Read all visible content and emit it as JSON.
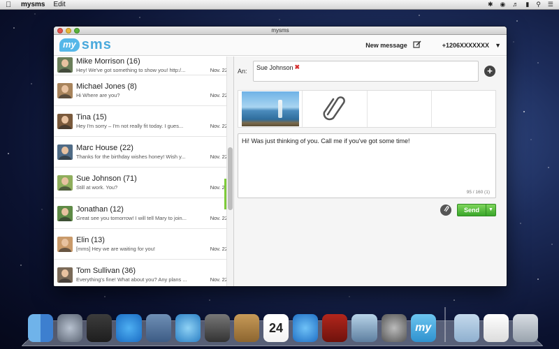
{
  "menubar": {
    "app_name": "mysms",
    "menu_edit": "Edit"
  },
  "window": {
    "title": "mysms"
  },
  "header": {
    "logo_my": "my",
    "logo_sms": "sms",
    "new_message_label": "New message",
    "phone_number": "+1206XXXXXXX"
  },
  "conversations": [
    {
      "name": "Mike Morrison (16)",
      "preview": "Hey! We've got something to show you! http:/...",
      "date": "Nov. 22",
      "avatar_color": "#6b7f5a"
    },
    {
      "name": "Michael Jones (8)",
      "preview": "Hi Where are you?",
      "date": "Nov. 22",
      "avatar_color": "#a8845c"
    },
    {
      "name": "Tina (15)",
      "preview": "Hey I'm sorry – I'm not really fit today. I gues...",
      "date": "Nov. 22",
      "avatar_color": "#7a5a3c"
    },
    {
      "name": "Marc House (22)",
      "preview": "Thanks for the birthday wishes honey! Wish y...",
      "date": "Nov. 22",
      "avatar_color": "#4f6b86"
    },
    {
      "name": "Sue Johnson (71)",
      "preview": "Still at work. You?",
      "date": "Nov. 22",
      "avatar_color": "#8fae5c"
    },
    {
      "name": "Jonathan (12)",
      "preview": "Great see you tomorrow! I will tell Mary to join...",
      "date": "Nov. 22",
      "avatar_color": "#5e8a46"
    },
    {
      "name": "Elin (13)",
      "preview": "[mms] Hey we are waiting for you!",
      "date": "Nov. 22",
      "avatar_color": "#c99a6a"
    },
    {
      "name": "Tom Sullivan (36)",
      "preview": "Everything's fine! What about you? Any plans ...",
      "date": "Nov. 22",
      "avatar_color": "#7a6a58"
    }
  ],
  "compose": {
    "to_label": "An:",
    "recipient": "Sue Johnson",
    "message": "Hi! Was just thinking of you. Call me if you've got some time!",
    "counter": "95 / 160 (1)",
    "send_label": "Send"
  },
  "dock": {
    "icons": [
      "finder-icon",
      "launchpad-icon",
      "photo-booth-icon",
      "app-store-icon",
      "mail-icon",
      "safari-icon",
      "facetime-icon",
      "address-book-icon",
      "calendar-icon",
      "itunes-icon",
      "photo-booth-curtain-icon",
      "iphoto-icon",
      "system-preferences-icon",
      "mysms-icon",
      "folder-icon",
      "document-icon",
      "trash-icon"
    ],
    "calendar_day": "24",
    "mysms_label": "my"
  }
}
